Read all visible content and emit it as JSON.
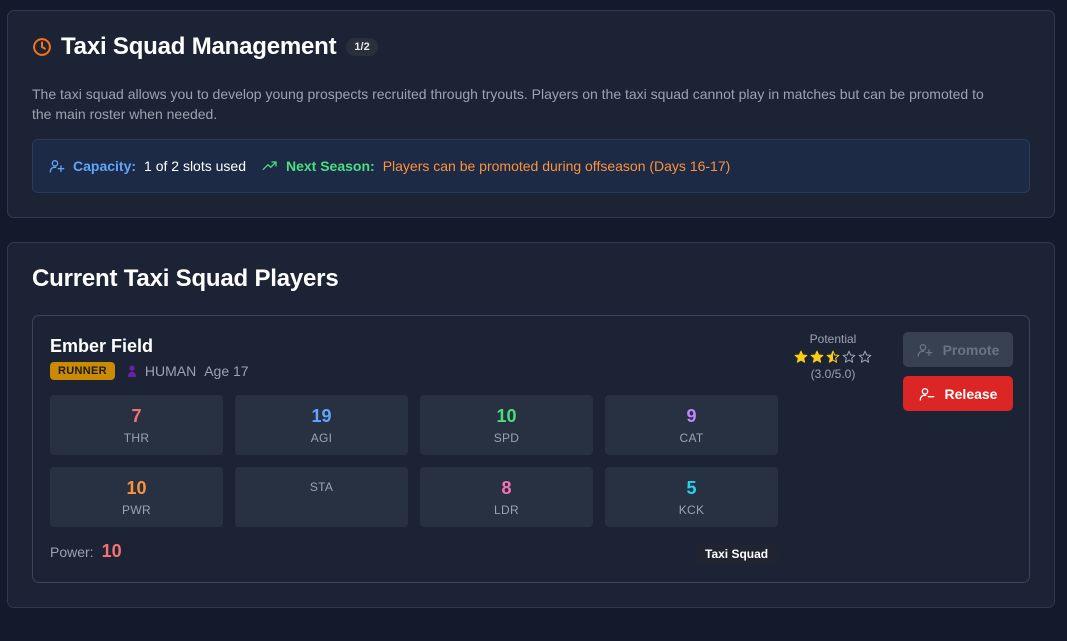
{
  "management": {
    "title": "Taxi Squad Management",
    "slot_badge": "1/2",
    "description": "The taxi squad allows you to develop young prospects recruited through tryouts. Players on the taxi squad cannot play in matches but can be promoted to the main roster when needed.",
    "capacity_label": "Capacity:",
    "capacity_value": "1 of 2 slots used",
    "next_season_label": "Next Season:",
    "next_season_value": "Players can be promoted during offseason (Days 16-17)",
    "colors": {
      "accent": "#f97316",
      "capacity": "#60a5fa",
      "next_season": "#4ade80",
      "next_season_text": "#fb923c"
    }
  },
  "squad": {
    "title": "Current Taxi Squad Players",
    "players": [
      {
        "name": "Ember Field",
        "position": "RUNNER",
        "race": "HUMAN",
        "race_icon": "person-icon",
        "age": "Age 17",
        "potential_label": "Potential",
        "potential_stars": 2.5,
        "potential_text": "(3.0/5.0)",
        "stats": [
          {
            "value": "7",
            "label": "THR",
            "color": "#f87171"
          },
          {
            "value": "19",
            "label": "AGI",
            "color": "#60a5fa"
          },
          {
            "value": "10",
            "label": "SPD",
            "color": "#4ade80"
          },
          {
            "value": "9",
            "label": "CAT",
            "color": "#c084fc"
          },
          {
            "value": "10",
            "label": "PWR",
            "color": "#fb923c"
          },
          {
            "value": "",
            "label": "STA",
            "color": "#9ca3af"
          },
          {
            "value": "8",
            "label": "LDR",
            "color": "#f472b6"
          },
          {
            "value": "5",
            "label": "KCK",
            "color": "#22d3ee"
          }
        ],
        "power_label": "Power:",
        "power_value": "10",
        "status_tag": "Taxi Squad",
        "promote_label": "Promote",
        "release_label": "Release"
      }
    ]
  }
}
